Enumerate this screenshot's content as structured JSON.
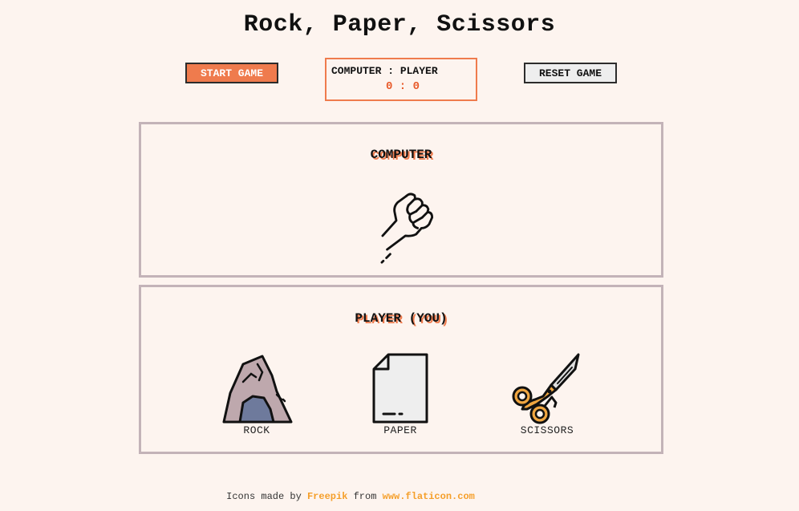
{
  "header": {
    "title": "Rock, Paper, Scissors"
  },
  "controls": {
    "start_label": "START GAME",
    "reset_label": "RESET GAME"
  },
  "scoreboard": {
    "label": "COMPUTER : PLAYER",
    "value": "0 : 0"
  },
  "computer_panel": {
    "title": "COMPUTER",
    "icon": "fist-icon"
  },
  "player_panel": {
    "title": "PLAYER (YOU)",
    "choices": [
      {
        "label": "ROCK",
        "icon": "rock-icon"
      },
      {
        "label": "PAPER",
        "icon": "paper-icon"
      },
      {
        "label": "SCISSORS",
        "icon": "scissors-icon"
      }
    ]
  },
  "footer": {
    "prefix": "Icons made by",
    "author": "Freepik",
    "middle": "from",
    "site": "www.flaticon.com"
  },
  "colors": {
    "background": "#fdf4ef",
    "accent": "#ef7b4d",
    "panel_border": "#c3b3b8",
    "link": "#f59f2a"
  }
}
